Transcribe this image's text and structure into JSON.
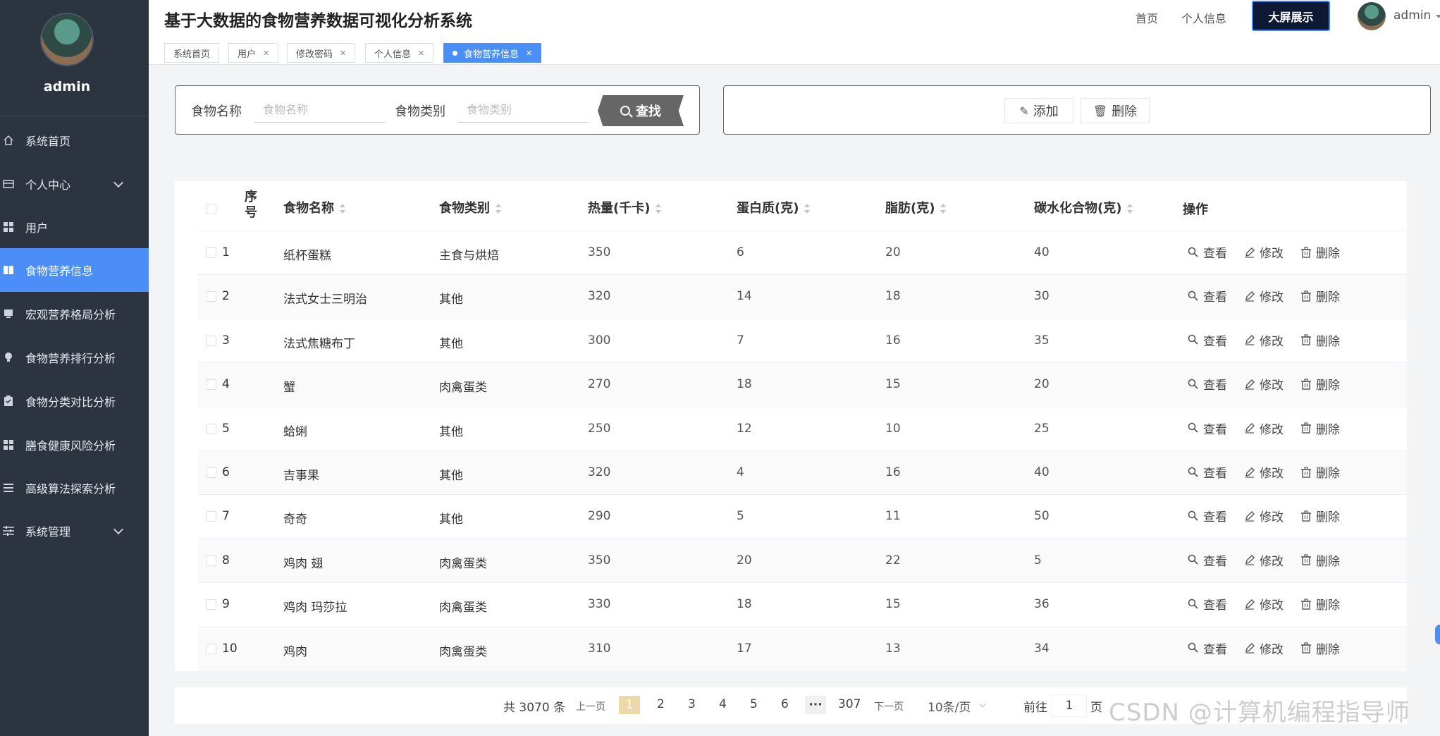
{
  "app": {
    "title": "基于大数据的食物营养数据可视化分析系统"
  },
  "header": {
    "nav_home": "首页",
    "nav_profile": "个人信息",
    "big_screen": "大屏展示",
    "user": "admin"
  },
  "sidebar": {
    "username": "admin",
    "items": [
      {
        "label": "系统首页",
        "icon": "home-icon"
      },
      {
        "label": "个人中心",
        "icon": "profile-icon"
      },
      {
        "label": "用户",
        "icon": "grid-icon"
      },
      {
        "label": "食物营养信息",
        "icon": "book-icon"
      },
      {
        "label": "宏观营养格局分析",
        "icon": "monitor-icon"
      },
      {
        "label": "食物营养排行分析",
        "icon": "bulb-icon"
      },
      {
        "label": "食物分类对比分析",
        "icon": "clipboard-icon"
      },
      {
        "label": "膳食健康风险分析",
        "icon": "grid-icon"
      },
      {
        "label": "高级算法探索分析",
        "icon": "list-icon"
      },
      {
        "label": "系统管理",
        "icon": "sliders-icon"
      }
    ]
  },
  "tags": [
    {
      "label": "系统首页",
      "closable": false
    },
    {
      "label": "用户",
      "closable": true
    },
    {
      "label": "修改密码",
      "closable": true
    },
    {
      "label": "个人信息",
      "closable": true
    },
    {
      "label": "食物营养信息",
      "closable": true,
      "active": true
    }
  ],
  "search": {
    "name_label": "食物名称",
    "name_placeholder": "食物名称",
    "category_label": "食物类别",
    "category_placeholder": "食物类别",
    "button": "查找"
  },
  "actions": {
    "add": "添加",
    "delete": "删除"
  },
  "table": {
    "headers": {
      "index": "序号",
      "name": "食物名称",
      "category": "食物类别",
      "calories": "热量(千卡)",
      "protein": "蛋白质(克)",
      "fat": "脂肪(克)",
      "carbs": "碳水化合物(克)",
      "ops": "操作"
    },
    "op_labels": {
      "view": "查看",
      "edit": "修改",
      "delete": "删除"
    },
    "rows": [
      {
        "index": "1",
        "name": "纸杯蛋糕",
        "category": "主食与烘焙",
        "calories": "350",
        "protein": "6",
        "fat": "20",
        "carbs": "40"
      },
      {
        "index": "2",
        "name": "法式女士三明治",
        "category": "其他",
        "calories": "320",
        "protein": "14",
        "fat": "18",
        "carbs": "30"
      },
      {
        "index": "3",
        "name": "法式焦糖布丁",
        "category": "其他",
        "calories": "300",
        "protein": "7",
        "fat": "16",
        "carbs": "35"
      },
      {
        "index": "4",
        "name": "蟹",
        "category": "肉禽蛋类",
        "calories": "270",
        "protein": "18",
        "fat": "15",
        "carbs": "20"
      },
      {
        "index": "5",
        "name": "蛤蜊",
        "category": "其他",
        "calories": "250",
        "protein": "12",
        "fat": "10",
        "carbs": "25"
      },
      {
        "index": "6",
        "name": "吉事果",
        "category": "其他",
        "calories": "320",
        "protein": "4",
        "fat": "16",
        "carbs": "40"
      },
      {
        "index": "7",
        "name": "奇奇",
        "category": "其他",
        "calories": "290",
        "protein": "5",
        "fat": "11",
        "carbs": "50"
      },
      {
        "index": "8",
        "name": "鸡肉 翅",
        "category": "肉禽蛋类",
        "calories": "350",
        "protein": "20",
        "fat": "22",
        "carbs": "5"
      },
      {
        "index": "9",
        "name": "鸡肉 玛莎拉",
        "category": "肉禽蛋类",
        "calories": "330",
        "protein": "18",
        "fat": "15",
        "carbs": "36"
      },
      {
        "index": "10",
        "name": "鸡肉",
        "category": "肉禽蛋类",
        "calories": "310",
        "protein": "17",
        "fat": "13",
        "carbs": "34"
      }
    ]
  },
  "pagination": {
    "total": "共 3070 条",
    "prev": "上一页",
    "pages": [
      "1",
      "2",
      "3",
      "4",
      "5",
      "6"
    ],
    "more": "···",
    "last": "307",
    "next": "下一页",
    "page_size": "10条/页",
    "goto_label": "前往",
    "goto_value": "1",
    "goto_suffix": "页"
  },
  "watermark": "CSDN @计算机编程指导师"
}
